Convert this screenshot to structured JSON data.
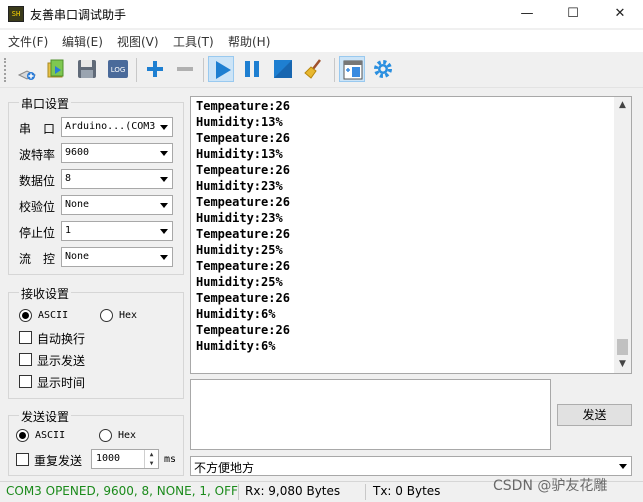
{
  "window": {
    "title": "友善串口调试助手",
    "icon_text": "SH"
  },
  "window_controls": {
    "minimize": "—",
    "maximize": "☐",
    "close": "✕"
  },
  "menu": [
    "文件(F)",
    "编辑(E)",
    "视图(V)",
    "工具(T)",
    "帮助(H)"
  ],
  "toolbar": {
    "icons": [
      "new-icon",
      "open-icon",
      "save-icon",
      "log-icon",
      "add-icon",
      "remove-icon",
      "play-icon",
      "pause-icon",
      "stop-icon",
      "clear-broom-icon",
      "layout-icon",
      "settings-gear-icon"
    ],
    "log_label": "LOG",
    "active": [
      "play-icon",
      "layout-icon"
    ]
  },
  "serial_settings": {
    "title": "串口设置",
    "rows": [
      {
        "label": "串　口",
        "value": "Arduino...(COM3"
      },
      {
        "label": "波特率",
        "value": "9600"
      },
      {
        "label": "数据位",
        "value": "8"
      },
      {
        "label": "校验位",
        "value": "None"
      },
      {
        "label": "停止位",
        "value": "1"
      },
      {
        "label": "流　控",
        "value": "None"
      }
    ]
  },
  "receive_settings": {
    "title": "接收设置",
    "ascii_label": "ASCII",
    "hex_label": "Hex",
    "mode": "ASCII",
    "options": [
      {
        "label": "自动换行",
        "checked": false
      },
      {
        "label": "显示发送",
        "checked": false
      },
      {
        "label": "显示时间",
        "checked": false
      }
    ]
  },
  "send_settings": {
    "title": "发送设置",
    "ascii_label": "ASCII",
    "hex_label": "Hex",
    "mode": "ASCII",
    "repeat_label": "重复发送",
    "repeat_checked": false,
    "interval": "1000",
    "interval_unit": "ms"
  },
  "receive_area": {
    "lines": [
      "Tempeature:26",
      "Humidity:13%",
      "Tempeature:26",
      "Humidity:13%",
      "Tempeature:26",
      "Humidity:23%",
      "Tempeature:26",
      "Humidity:23%",
      "Tempeature:26",
      "Humidity:25%",
      "Tempeature:26",
      "Humidity:25%",
      "Tempeature:26",
      "Humidity:6%",
      "Tempeature:26",
      "Humidity:6%"
    ]
  },
  "send_area": {
    "text": "",
    "send_button": "发送",
    "history_value": "不方便地方"
  },
  "status_bar": {
    "connection": "COM3 OPENED, 9600, 8, NONE, 1, OFF",
    "rx": "Rx: 9,080 Bytes",
    "tx": "Tx: 0 Bytes"
  },
  "watermark": "CSDN @驴友花雕",
  "colors": {
    "status_ok": "#1a8a1a",
    "toolbar_active": "#cce4f7",
    "accent_blue": "#1e7fd1"
  }
}
